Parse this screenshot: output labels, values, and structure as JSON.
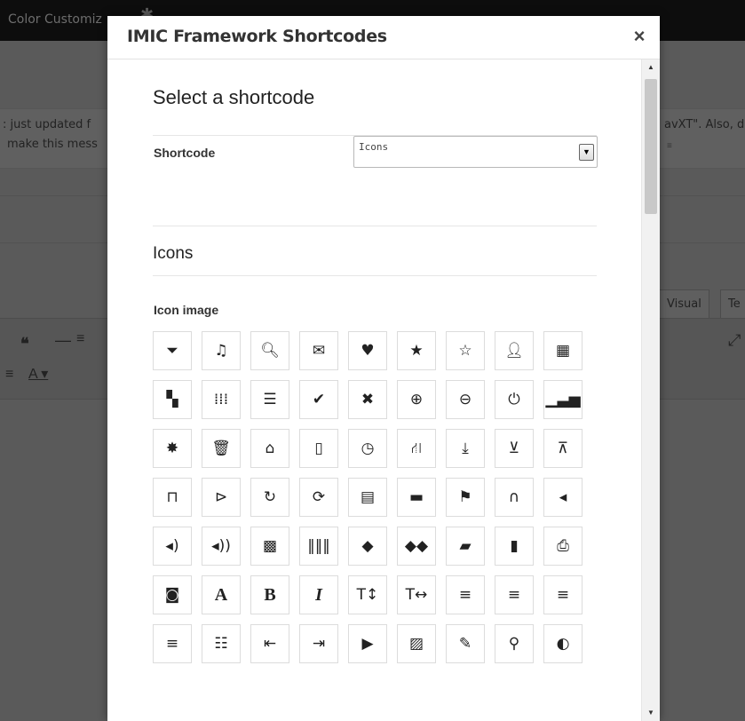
{
  "background": {
    "topbar_text": "Color Customiz",
    "notice_line1": ": just updated f",
    "notice_line2": "make this mess",
    "notice_right": "avXT\". Also, d",
    "tab_visual": "Visual",
    "tab_text": "Te"
  },
  "modal": {
    "title": "IMIC Framework Shortcodes",
    "close_symbol": "×",
    "heading": "Select a shortcode",
    "shortcode_label": "Shortcode",
    "shortcode_value": "Icons",
    "section_title": "Icons",
    "icon_image_label": "Icon image"
  },
  "icons": [
    [
      "filter-icon",
      "music-icon",
      "search-icon",
      "envelope-icon",
      "heart-icon",
      "star-icon",
      "star-empty-icon",
      "user-icon",
      "film-icon"
    ],
    [
      "th-large-icon",
      "th-icon",
      "th-list-icon",
      "ok-icon",
      "remove-icon",
      "zoom-in-icon",
      "zoom-out-icon",
      "off-icon",
      "signal-icon"
    ],
    [
      "cog-icon",
      "trash-icon",
      "home-icon",
      "file-icon",
      "time-icon",
      "road-icon",
      "download-alt-icon",
      "download-icon",
      "upload-icon"
    ],
    [
      "inbox-icon",
      "play-circle-icon",
      "repeat-icon",
      "refresh-icon",
      "list-alt-icon",
      "lock-icon",
      "flag-icon",
      "headphones-icon",
      "volume-off-icon"
    ],
    [
      "volume-down-icon",
      "volume-up-icon",
      "qrcode-icon",
      "barcode-icon",
      "tag-icon",
      "tags-icon",
      "book-icon",
      "bookmark-icon",
      "print-icon"
    ],
    [
      "camera-icon",
      "font-icon",
      "bold-icon",
      "italic-icon",
      "text-height-icon",
      "text-width-icon",
      "align-left-icon",
      "align-center-icon",
      "align-right-icon"
    ],
    [
      "align-justify-icon",
      "list-icon",
      "indent-left-icon",
      "indent-right-icon",
      "facetime-video-icon",
      "picture-icon",
      "pencil-icon",
      "map-marker-icon",
      "adjust-icon"
    ]
  ]
}
